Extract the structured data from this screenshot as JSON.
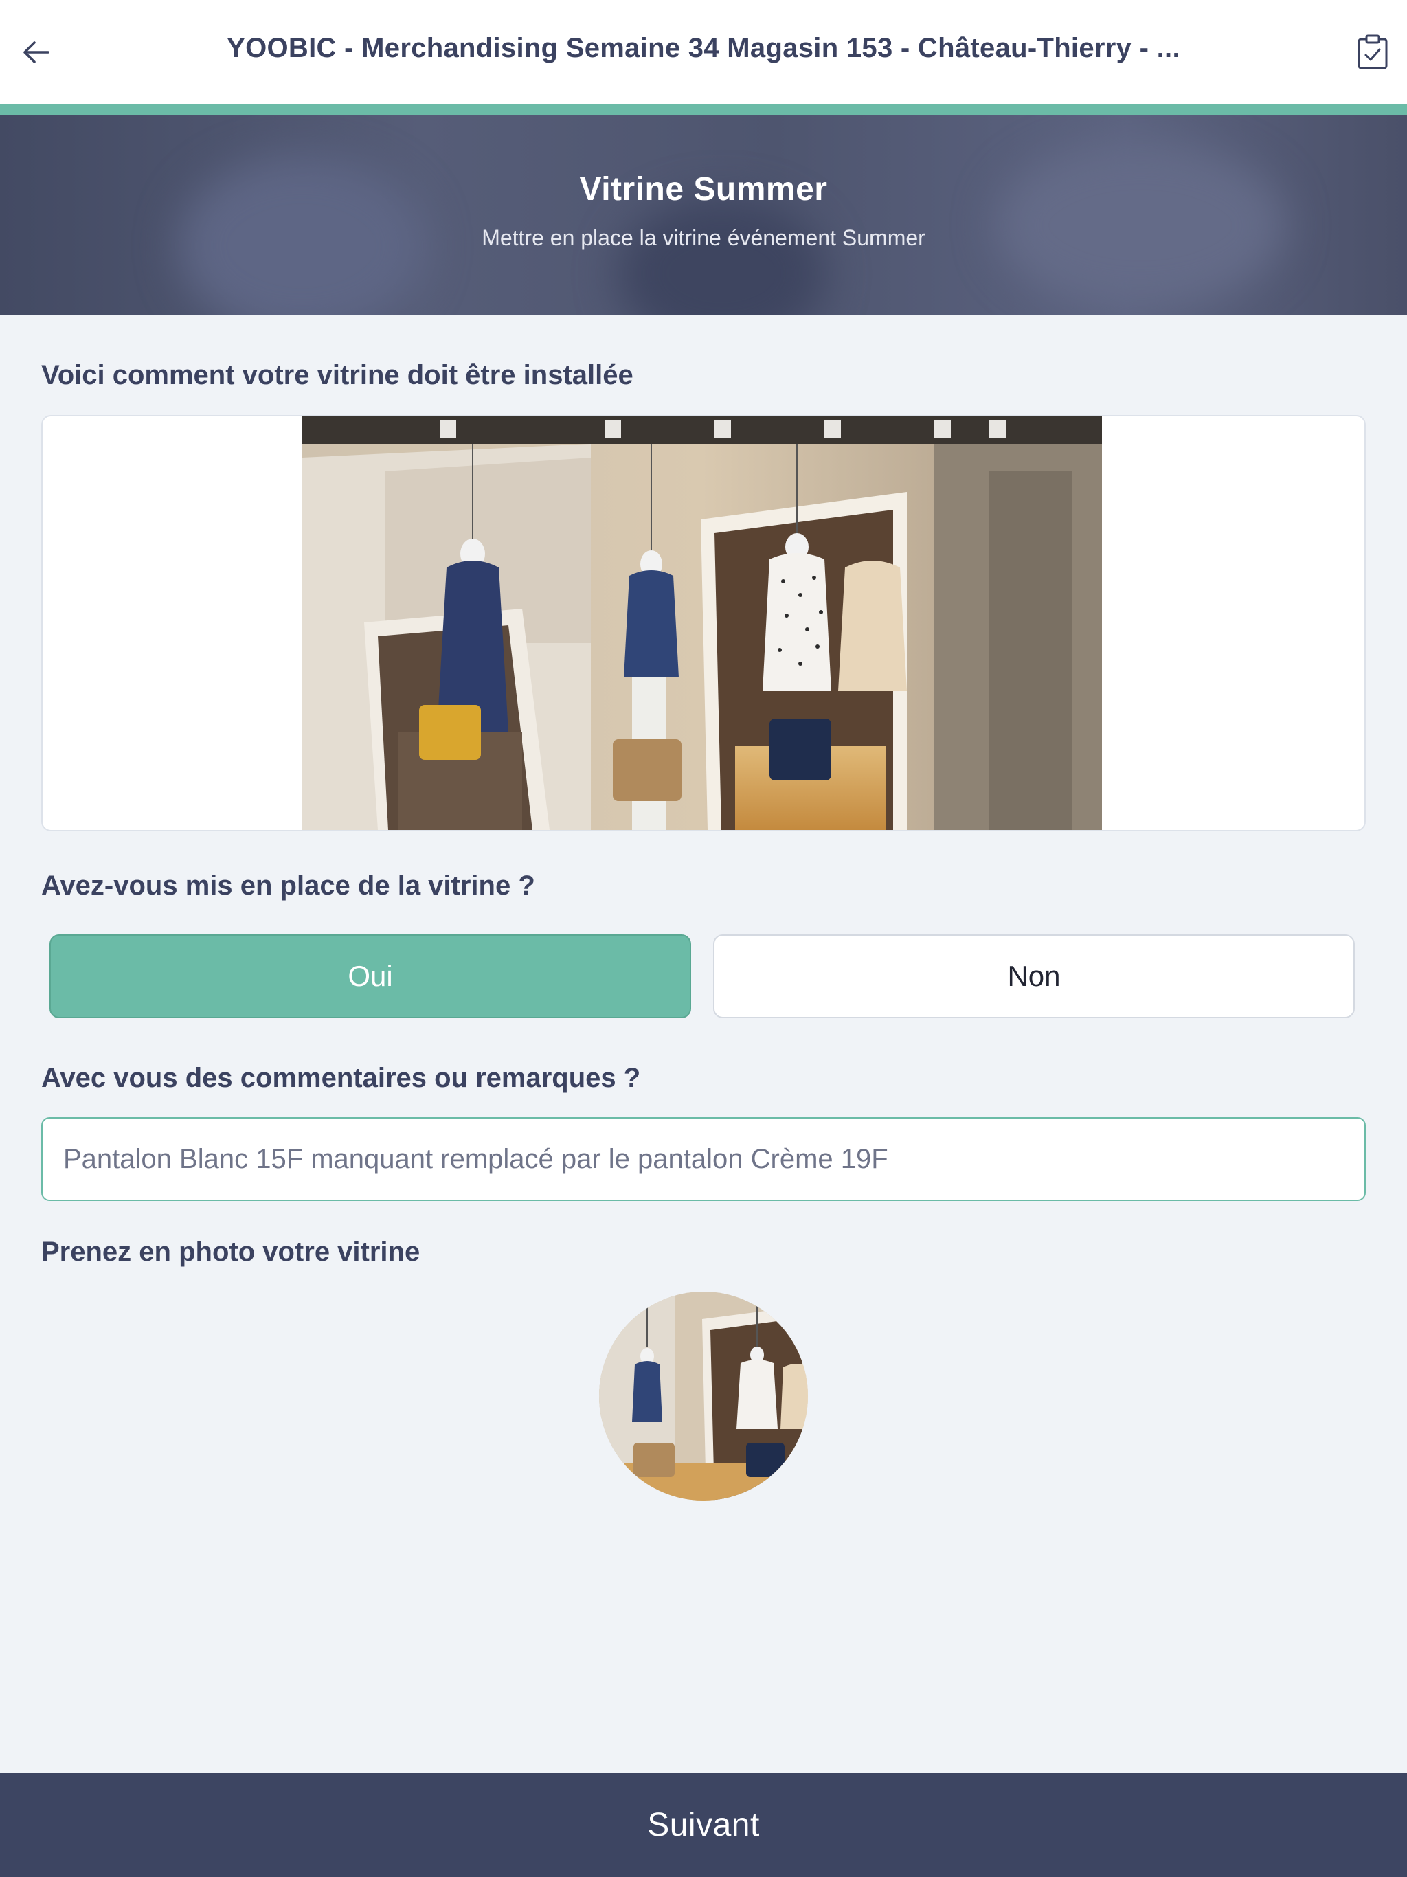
{
  "header": {
    "title": "YOOBIC - Merchandising Semaine 34 Magasin 153 - Château-Thierry - ...",
    "back_icon": "arrow-left-icon",
    "checklist_icon": "clipboard-check-icon"
  },
  "progress": {
    "value": 1.0
  },
  "hero": {
    "title": "Vitrine Summer",
    "subtitle": "Mettre en place la vitrine événement Summer"
  },
  "form": {
    "reference_label": "Voici comment votre vitrine doit être installée",
    "question_label": "Avez-vous mis en place de la vitrine ?",
    "yes_label": "Oui",
    "no_label": "Non",
    "selected": "Oui",
    "comment_label": "Avec vous des commentaires ou remarques ?",
    "comment_value": "Pantalon Blanc 15F manquant remplacé par le pantalon Crème 19F",
    "photo_label": "Prenez en photo votre vitrine"
  },
  "footer": {
    "next_label": "Suivant"
  },
  "colors": {
    "accent": "#6bbba7",
    "navy": "#3d4562",
    "background": "#f0f3f7",
    "text": "#3b4260"
  }
}
